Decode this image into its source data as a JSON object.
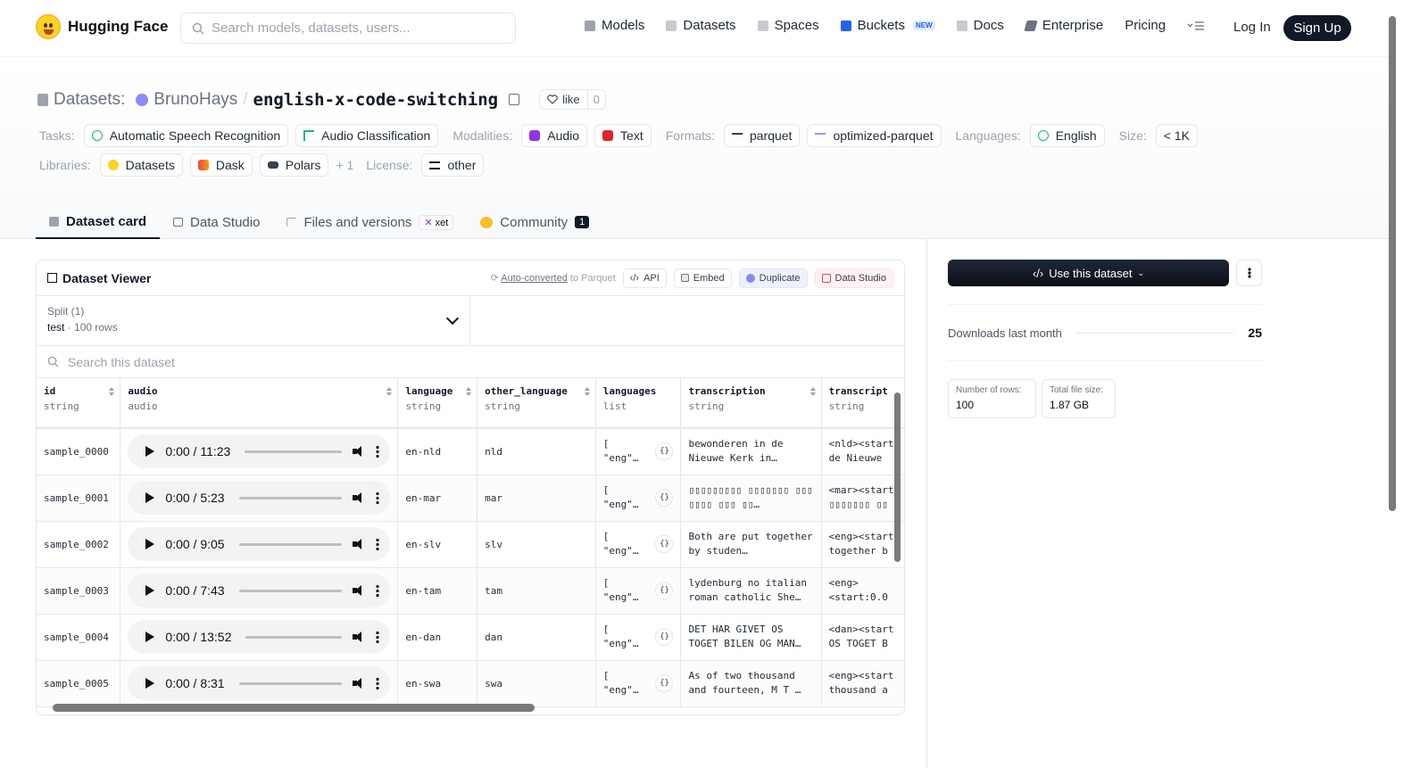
{
  "nav": {
    "brand": "Hugging Face",
    "search_placeholder": "Search models, datasets, users...",
    "links": [
      {
        "label": "Models",
        "icon": "cube-icon",
        "color": "#9ca3af"
      },
      {
        "label": "Datasets",
        "icon": "database-icon",
        "color": "#9ca3af"
      },
      {
        "label": "Spaces",
        "icon": "grid-icon",
        "color": "#9ca3af"
      },
      {
        "label": "Buckets",
        "icon": "bucket-icon",
        "color": "#2563eb"
      },
      {
        "label": "Docs",
        "icon": "book-icon",
        "color": "#9ca3af"
      },
      {
        "label": "Enterprise",
        "icon": "enterprise-icon",
        "color": "#6b7280"
      }
    ],
    "new_badge": "NEW",
    "pricing": "Pricing",
    "login": "Log In",
    "signup": "Sign Up"
  },
  "header": {
    "prefix": "Datasets:",
    "owner": "BrunoHays",
    "slash": "/",
    "name": "english-x-code-switching",
    "like_label": "like",
    "like_count": "0",
    "tasks_label": "Tasks:",
    "tasks": [
      "Automatic Speech Recognition",
      "Audio Classification"
    ],
    "modalities_label": "Modalities:",
    "modalities": [
      "Audio",
      "Text"
    ],
    "formats_label": "Formats:",
    "formats": [
      "parquet",
      "optimized-parquet"
    ],
    "languages_label": "Languages:",
    "languages": [
      "English"
    ],
    "size_label": "Size:",
    "size": "< 1K",
    "libraries_label": "Libraries:",
    "libraries": [
      "Datasets",
      "Dask",
      "Polars"
    ],
    "libraries_more": "+ 1",
    "license_label": "License:",
    "license": "other"
  },
  "tabs": {
    "dataset_card": "Dataset card",
    "data_studio": "Data Studio",
    "files": "Files and versions",
    "xet": "xet",
    "community": "Community",
    "community_count": "1"
  },
  "viewer": {
    "title": "Dataset Viewer",
    "auto_converted": "Auto-converted",
    "to_parquet": " to Parquet",
    "api": "API",
    "embed": "Embed",
    "duplicate": "Duplicate",
    "data_studio": "Data Studio",
    "split_label": "Split (1)",
    "split_value": "test",
    "split_sep": "·",
    "split_rows": "100 rows",
    "search_placeholder": "Search this dataset",
    "columns": [
      {
        "name": "id",
        "type": "string"
      },
      {
        "name": "audio",
        "type": "audio"
      },
      {
        "name": "language",
        "type": "string"
      },
      {
        "name": "other_language",
        "type": "string"
      },
      {
        "name": "languages",
        "type": "list"
      },
      {
        "name": "transcription",
        "type": "string"
      },
      {
        "name": "transcript",
        "type": "string"
      }
    ],
    "rows": [
      {
        "id": "sample_0000",
        "time": "0:00 / 11:23",
        "language": "en-nld",
        "other": "nld",
        "langs": "[ \"eng\"…",
        "transcription": "bewonderen in de Nieuwe Kerk in…",
        "transcript": "<nld><start de Nieuwe"
      },
      {
        "id": "sample_0001",
        "time": "0:00 / 5:23",
        "language": "en-mar",
        "other": "mar",
        "langs": "[ \"eng\"…",
        "transcription": "▯▯▯▯▯▯▯▯▯ ▯▯▯▯▯▯▯ ▯▯▯ ▯▯▯▯ ▯▯▯ ▯▯…",
        "transcript": "<mar><start ▯▯▯▯▯▯▯ ▯▯"
      },
      {
        "id": "sample_0002",
        "time": "0:00 / 9:05",
        "language": "en-slv",
        "other": "slv",
        "langs": "[ \"eng\"…",
        "transcription": "Both are put together by studen…",
        "transcript": "<eng><start together b"
      },
      {
        "id": "sample_0003",
        "time": "0:00 / 7:43",
        "language": "en-tam",
        "other": "tam",
        "langs": "[ \"eng\"…",
        "transcription": "lydenburg no italian roman catholic She…",
        "transcript": "<eng> <start:0.0"
      },
      {
        "id": "sample_0004",
        "time": "0:00 / 13:52",
        "language": "en-dan",
        "other": "dan",
        "langs": "[ \"eng\"…",
        "transcription": "DET HAR GIVET OS TOGET BILEN OG MAN…",
        "transcript": "<dan><start OS TOGET B"
      },
      {
        "id": "sample_0005",
        "time": "0:00 / 8:31",
        "language": "en-swa",
        "other": "swa",
        "langs": "[ \"eng\"…",
        "transcription": "As of two thousand and fourteen, M T …",
        "transcript": "<eng><start thousand a"
      }
    ],
    "json_icon": "{}"
  },
  "sidebar": {
    "use_dataset": "Use this dataset",
    "downloads_label": "Downloads last month",
    "downloads": "25",
    "rows_label": "Number of rows:",
    "rows_value": "100",
    "size_label": "Total file size:",
    "size_value": "1.87 GB"
  }
}
